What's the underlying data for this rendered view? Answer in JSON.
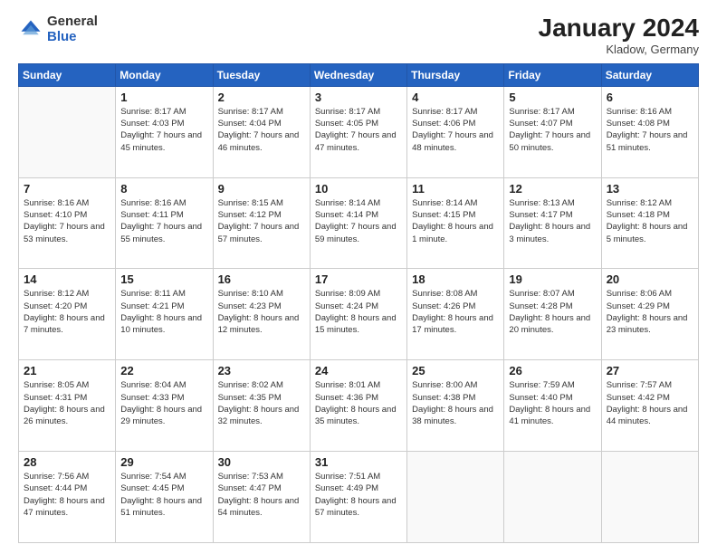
{
  "header": {
    "logo_general": "General",
    "logo_blue": "Blue",
    "month_year": "January 2024",
    "location": "Kladow, Germany"
  },
  "weekdays": [
    "Sunday",
    "Monday",
    "Tuesday",
    "Wednesday",
    "Thursday",
    "Friday",
    "Saturday"
  ],
  "weeks": [
    [
      {
        "day": "",
        "sunrise": "",
        "sunset": "",
        "daylight": ""
      },
      {
        "day": "1",
        "sunrise": "Sunrise: 8:17 AM",
        "sunset": "Sunset: 4:03 PM",
        "daylight": "Daylight: 7 hours and 45 minutes."
      },
      {
        "day": "2",
        "sunrise": "Sunrise: 8:17 AM",
        "sunset": "Sunset: 4:04 PM",
        "daylight": "Daylight: 7 hours and 46 minutes."
      },
      {
        "day": "3",
        "sunrise": "Sunrise: 8:17 AM",
        "sunset": "Sunset: 4:05 PM",
        "daylight": "Daylight: 7 hours and 47 minutes."
      },
      {
        "day": "4",
        "sunrise": "Sunrise: 8:17 AM",
        "sunset": "Sunset: 4:06 PM",
        "daylight": "Daylight: 7 hours and 48 minutes."
      },
      {
        "day": "5",
        "sunrise": "Sunrise: 8:17 AM",
        "sunset": "Sunset: 4:07 PM",
        "daylight": "Daylight: 7 hours and 50 minutes."
      },
      {
        "day": "6",
        "sunrise": "Sunrise: 8:16 AM",
        "sunset": "Sunset: 4:08 PM",
        "daylight": "Daylight: 7 hours and 51 minutes."
      }
    ],
    [
      {
        "day": "7",
        "sunrise": "Sunrise: 8:16 AM",
        "sunset": "Sunset: 4:10 PM",
        "daylight": "Daylight: 7 hours and 53 minutes."
      },
      {
        "day": "8",
        "sunrise": "Sunrise: 8:16 AM",
        "sunset": "Sunset: 4:11 PM",
        "daylight": "Daylight: 7 hours and 55 minutes."
      },
      {
        "day": "9",
        "sunrise": "Sunrise: 8:15 AM",
        "sunset": "Sunset: 4:12 PM",
        "daylight": "Daylight: 7 hours and 57 minutes."
      },
      {
        "day": "10",
        "sunrise": "Sunrise: 8:14 AM",
        "sunset": "Sunset: 4:14 PM",
        "daylight": "Daylight: 7 hours and 59 minutes."
      },
      {
        "day": "11",
        "sunrise": "Sunrise: 8:14 AM",
        "sunset": "Sunset: 4:15 PM",
        "daylight": "Daylight: 8 hours and 1 minute."
      },
      {
        "day": "12",
        "sunrise": "Sunrise: 8:13 AM",
        "sunset": "Sunset: 4:17 PM",
        "daylight": "Daylight: 8 hours and 3 minutes."
      },
      {
        "day": "13",
        "sunrise": "Sunrise: 8:12 AM",
        "sunset": "Sunset: 4:18 PM",
        "daylight": "Daylight: 8 hours and 5 minutes."
      }
    ],
    [
      {
        "day": "14",
        "sunrise": "Sunrise: 8:12 AM",
        "sunset": "Sunset: 4:20 PM",
        "daylight": "Daylight: 8 hours and 7 minutes."
      },
      {
        "day": "15",
        "sunrise": "Sunrise: 8:11 AM",
        "sunset": "Sunset: 4:21 PM",
        "daylight": "Daylight: 8 hours and 10 minutes."
      },
      {
        "day": "16",
        "sunrise": "Sunrise: 8:10 AM",
        "sunset": "Sunset: 4:23 PM",
        "daylight": "Daylight: 8 hours and 12 minutes."
      },
      {
        "day": "17",
        "sunrise": "Sunrise: 8:09 AM",
        "sunset": "Sunset: 4:24 PM",
        "daylight": "Daylight: 8 hours and 15 minutes."
      },
      {
        "day": "18",
        "sunrise": "Sunrise: 8:08 AM",
        "sunset": "Sunset: 4:26 PM",
        "daylight": "Daylight: 8 hours and 17 minutes."
      },
      {
        "day": "19",
        "sunrise": "Sunrise: 8:07 AM",
        "sunset": "Sunset: 4:28 PM",
        "daylight": "Daylight: 8 hours and 20 minutes."
      },
      {
        "day": "20",
        "sunrise": "Sunrise: 8:06 AM",
        "sunset": "Sunset: 4:29 PM",
        "daylight": "Daylight: 8 hours and 23 minutes."
      }
    ],
    [
      {
        "day": "21",
        "sunrise": "Sunrise: 8:05 AM",
        "sunset": "Sunset: 4:31 PM",
        "daylight": "Daylight: 8 hours and 26 minutes."
      },
      {
        "day": "22",
        "sunrise": "Sunrise: 8:04 AM",
        "sunset": "Sunset: 4:33 PM",
        "daylight": "Daylight: 8 hours and 29 minutes."
      },
      {
        "day": "23",
        "sunrise": "Sunrise: 8:02 AM",
        "sunset": "Sunset: 4:35 PM",
        "daylight": "Daylight: 8 hours and 32 minutes."
      },
      {
        "day": "24",
        "sunrise": "Sunrise: 8:01 AM",
        "sunset": "Sunset: 4:36 PM",
        "daylight": "Daylight: 8 hours and 35 minutes."
      },
      {
        "day": "25",
        "sunrise": "Sunrise: 8:00 AM",
        "sunset": "Sunset: 4:38 PM",
        "daylight": "Daylight: 8 hours and 38 minutes."
      },
      {
        "day": "26",
        "sunrise": "Sunrise: 7:59 AM",
        "sunset": "Sunset: 4:40 PM",
        "daylight": "Daylight: 8 hours and 41 minutes."
      },
      {
        "day": "27",
        "sunrise": "Sunrise: 7:57 AM",
        "sunset": "Sunset: 4:42 PM",
        "daylight": "Daylight: 8 hours and 44 minutes."
      }
    ],
    [
      {
        "day": "28",
        "sunrise": "Sunrise: 7:56 AM",
        "sunset": "Sunset: 4:44 PM",
        "daylight": "Daylight: 8 hours and 47 minutes."
      },
      {
        "day": "29",
        "sunrise": "Sunrise: 7:54 AM",
        "sunset": "Sunset: 4:45 PM",
        "daylight": "Daylight: 8 hours and 51 minutes."
      },
      {
        "day": "30",
        "sunrise": "Sunrise: 7:53 AM",
        "sunset": "Sunset: 4:47 PM",
        "daylight": "Daylight: 8 hours and 54 minutes."
      },
      {
        "day": "31",
        "sunrise": "Sunrise: 7:51 AM",
        "sunset": "Sunset: 4:49 PM",
        "daylight": "Daylight: 8 hours and 57 minutes."
      },
      {
        "day": "",
        "sunrise": "",
        "sunset": "",
        "daylight": ""
      },
      {
        "day": "",
        "sunrise": "",
        "sunset": "",
        "daylight": ""
      },
      {
        "day": "",
        "sunrise": "",
        "sunset": "",
        "daylight": ""
      }
    ]
  ]
}
